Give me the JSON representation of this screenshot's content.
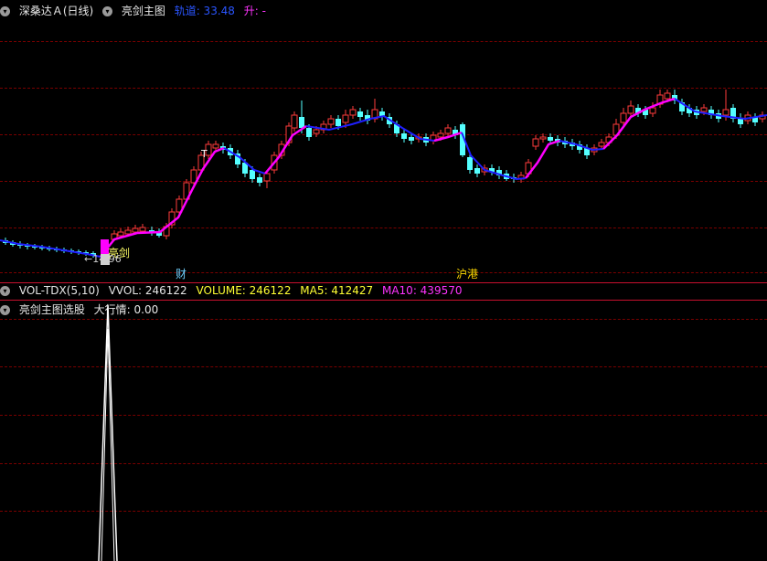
{
  "main_header": {
    "stock_name": "深桑达Ａ(日线)",
    "indicator": "亮剑主图",
    "track_label": "轨道: 33.48",
    "rise_label": "升: -"
  },
  "volume_header": {
    "indicator": "VOL-TDX(5,10)",
    "vvol": "VVOL: 246122",
    "volume": "VOLUME: 246122",
    "ma5": "MA5: 412427",
    "ma10": "MA10: 439570"
  },
  "select_header": {
    "indicator": "亮剑主图选股",
    "signal": "大行情: 0.00"
  },
  "chart_labels": {
    "buy_signal": "亮剑",
    "low_price": "←14.96",
    "fin_marker": "财",
    "hk_marker": "沪港",
    "t_marker": "T"
  },
  "colors": {
    "up": "#ff3b3b",
    "down": "#54ffff",
    "trend_up": "#ff00ff",
    "trend_down": "#1f1fff",
    "grid": "#7a0000",
    "border": "#c8102e",
    "signal": "#ffffff"
  },
  "icons": [
    "dropdown-icon"
  ]
}
